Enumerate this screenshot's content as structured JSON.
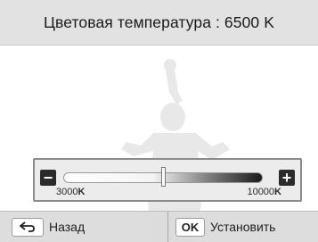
{
  "header": {
    "title": "Цветовая температура : 6500 K"
  },
  "slider": {
    "min_label": "3000",
    "max_label": "10000",
    "unit": "K",
    "value": 6500,
    "min": 3000,
    "max": 10000
  },
  "footer": {
    "back_label": "Назад",
    "ok_key": "OK",
    "set_label": "Установить"
  },
  "icons": {
    "back": "return-arrow-icon",
    "minus": "minus-icon",
    "plus": "plus-icon"
  },
  "colors": {
    "track_start": "#ffffff",
    "track_end": "#1a1a1a"
  }
}
